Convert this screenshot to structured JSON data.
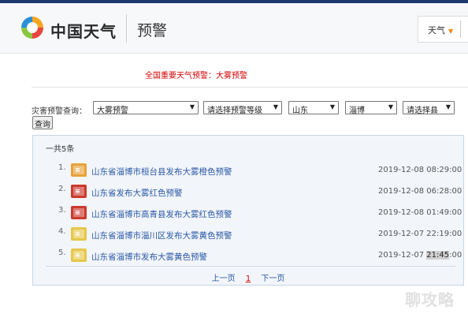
{
  "header": {
    "brand": "中国天气",
    "section": "预警",
    "city_select": "天气"
  },
  "alert_banner": "全国重要天气预警：大雾预警",
  "query": {
    "label": "灾害预警查询：",
    "type": "大雾预警",
    "level": "请选择预警等级",
    "province": "山东",
    "city": "淄博",
    "county": "请选择县",
    "button": "查询"
  },
  "results": {
    "count": "一共5条",
    "items": [
      {
        "num": "1.",
        "title": "山东省淄博市桓台县发布大雾橙色预警",
        "time": "2019-12-08 08:29:00",
        "level_color": "#e8a23a",
        "icon": "fog-orange-alert-icon"
      },
      {
        "num": "2.",
        "title": "山东省发布大雾红色预警",
        "time": "2019-12-08 06:28:00",
        "level_color": "#cc3a2e",
        "icon": "fog-red-alert-icon"
      },
      {
        "num": "3.",
        "title": "山东省淄博市高青县发布大雾红色预警",
        "time": "2019-12-08 01:49:00",
        "level_color": "#cc3a2e",
        "icon": "fog-red-alert-icon"
      },
      {
        "num": "4.",
        "title": "山东省淄博市淄川区发布大雾黄色预警",
        "time": "2019-12-07 22:19:00",
        "level_color": "#e6c84a",
        "icon": "fog-yellow-alert-icon"
      },
      {
        "num": "5.",
        "title": "山东省淄博市发布大雾黄色预警",
        "time_prefix": "2019-12-07 ",
        "time_highlight": "21:45",
        "time_suffix": ":00",
        "level_color": "#e6c84a",
        "icon": "fog-yellow-alert-icon"
      }
    ]
  },
  "pager": {
    "prev": "上一页",
    "current": "1",
    "next": "下一页"
  },
  "watermark": "聊攻略"
}
